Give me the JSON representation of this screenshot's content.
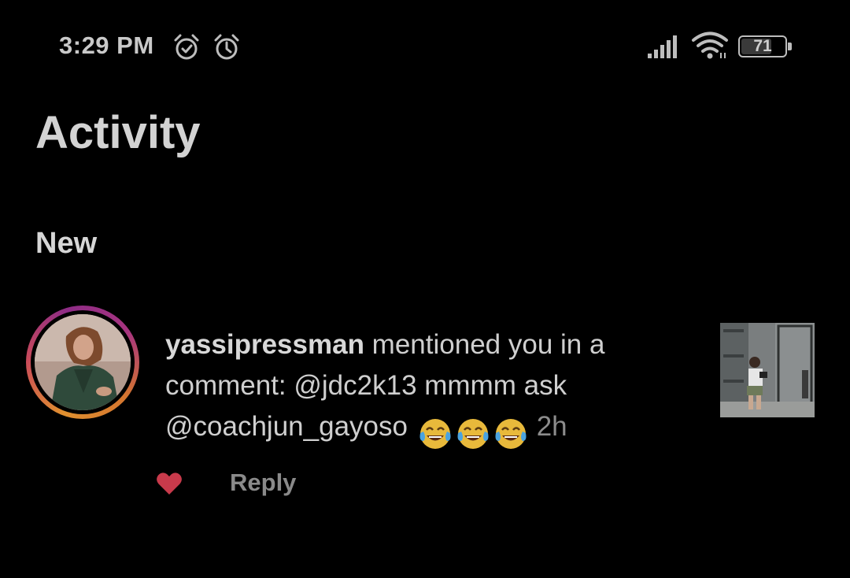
{
  "status_bar": {
    "time": "3:29 PM",
    "battery_level": "71",
    "battery_fraction": 0.71,
    "icons": [
      "alarm-clock-icon",
      "alarm-icon",
      "signal-icon",
      "wifi-icon",
      "battery-icon"
    ]
  },
  "header": {
    "title": "Activity"
  },
  "sections": [
    {
      "title": "New",
      "notifications": [
        {
          "username": "yassipressman",
          "message": " mentioned you in a comment: @jdc2k13 mmmm ask @coachjun_gayoso ",
          "emojis": [
            "face-with-tears-of-joy",
            "face-with-tears-of-joy",
            "face-with-tears-of-joy"
          ],
          "time": "2h",
          "reply_label": "Reply",
          "liked": true
        }
      ]
    }
  ],
  "colors": {
    "background": "#000000",
    "text_primary": "#d3d3d3",
    "text_secondary": "#8c8c8c",
    "like_red": "#c83a4b",
    "story_ring": [
      "#e0902f",
      "#c94a5a",
      "#8e2c86"
    ]
  }
}
